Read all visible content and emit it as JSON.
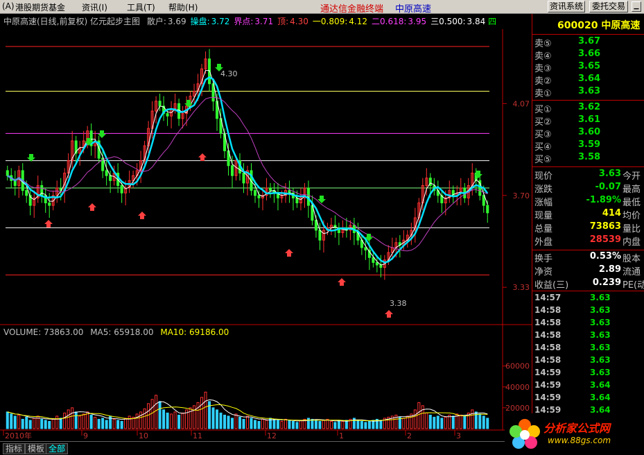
{
  "menu": {
    "items": [
      "(A)",
      "港股期货基金",
      "资讯(I)",
      "工具(T)",
      "帮助(H)"
    ],
    "title": "通达信金融终端",
    "stock": "中原高速",
    "buttons": [
      "资讯系统",
      "委托交易"
    ]
  },
  "chart_header": {
    "name": "中原高速(日线,前复权) 亿元起步主图",
    "fields": [
      {
        "label": "散户:",
        "value": "3.69",
        "color": "#c0c0c0"
      },
      {
        "label": "操盘:",
        "value": "3.72",
        "color": "#00ffff"
      },
      {
        "label": "界点:",
        "value": "3.71",
        "color": "#ff40ff"
      },
      {
        "label": "顶:",
        "value": "4.30",
        "color": "#ff4040"
      },
      {
        "label": "一0.809:",
        "value": "4.12",
        "color": "#ffff00"
      },
      {
        "label": "二0.618:",
        "value": "3.95",
        "color": "#ff40ff"
      },
      {
        "label": "三0.500:",
        "value": "3.84",
        "color": "#ffffff"
      }
    ],
    "end_icon": "四"
  },
  "volume_header": {
    "volume": "VOLUME: 73863.00",
    "ma5": "MA5: 65918.00",
    "ma10": "MA10: 69186.00"
  },
  "chart_data": {
    "type": "candlestick",
    "price_ticks": [
      "4.07",
      "3.70",
      "3.33"
    ],
    "volume_ticks": [
      "60000",
      "40000",
      "20000"
    ],
    "date_labels": [
      "2010年",
      "9",
      "10",
      "11",
      "12",
      "1",
      "2",
      "3"
    ],
    "annotations": [
      "4.30",
      "3.38"
    ],
    "levels": [
      4.3,
      4.12,
      3.95,
      3.84,
      3.73,
      3.57,
      3.38
    ],
    "level_colors": [
      "#ff2020",
      "#ffff60",
      "#ff40ff",
      "#ffffff",
      "#80ff80",
      "#ffffff",
      "#ff2020"
    ],
    "price_min": 3.23,
    "price_max": 4.37,
    "vol_max": 85000,
    "closes": [
      3.78,
      3.76,
      3.74,
      3.8,
      3.72,
      3.7,
      3.66,
      3.69,
      3.74,
      3.7,
      3.67,
      3.66,
      3.7,
      3.73,
      3.72,
      3.79,
      3.84,
      3.92,
      3.87,
      3.89,
      3.92,
      3.96,
      3.9,
      3.92,
      3.85,
      3.8,
      3.78,
      3.76,
      3.79,
      3.74,
      3.71,
      3.73,
      3.76,
      3.78,
      3.8,
      3.84,
      3.9,
      3.97,
      4.04,
      4.08,
      4.06,
      4.03,
      4.02,
      4.05,
      4.07,
      4.01,
      4.03,
      4.06,
      4.1,
      4.12,
      4.15,
      4.21,
      4.25,
      4.15,
      4.08,
      4.01,
      3.95,
      3.88,
      3.82,
      3.78,
      3.84,
      3.79,
      3.75,
      3.8,
      3.72,
      3.7,
      3.69,
      3.7,
      3.73,
      3.72,
      3.71,
      3.69,
      3.7,
      3.72,
      3.71,
      3.69,
      3.67,
      3.69,
      3.73,
      3.66,
      3.6,
      3.56,
      3.52,
      3.56,
      3.57,
      3.58,
      3.57,
      3.55,
      3.57,
      3.56,
      3.58,
      3.55,
      3.52,
      3.49,
      3.48,
      3.45,
      3.43,
      3.42,
      3.41,
      3.44,
      3.47,
      3.49,
      3.51,
      3.5,
      3.52,
      3.54,
      3.56,
      3.61,
      3.67,
      3.74,
      3.77,
      3.74,
      3.72,
      3.7,
      3.67,
      3.69,
      3.72,
      3.7,
      3.71,
      3.73,
      3.69,
      3.74,
      3.79,
      3.76,
      3.7,
      3.66,
      3.63
    ],
    "volumes": [
      16000,
      14000,
      12000,
      13000,
      9000,
      11000,
      8000,
      10000,
      12000,
      9000,
      8000,
      7000,
      9000,
      12000,
      10000,
      15000,
      18000,
      20000,
      16000,
      12000,
      14000,
      16000,
      13000,
      11000,
      9000,
      10000,
      8000,
      12000,
      9000,
      8000,
      7000,
      10000,
      12000,
      11000,
      14000,
      16000,
      19000,
      24000,
      28000,
      32000,
      26000,
      18000,
      15000,
      14000,
      16000,
      13000,
      15000,
      18000,
      20000,
      22000,
      25000,
      30000,
      35000,
      26000,
      20000,
      18000,
      15000,
      13000,
      12000,
      10000,
      14000,
      11000,
      9000,
      12000,
      10000,
      8000,
      7000,
      9000,
      8000,
      10000,
      9000,
      8000,
      7000,
      9000,
      8000,
      7000,
      6000,
      8000,
      9000,
      10000,
      9000,
      8000,
      7000,
      8000,
      9000,
      7000,
      6000,
      8000,
      7000,
      8000,
      9000,
      10000,
      8000,
      7000,
      6000,
      7000,
      8000,
      9000,
      8000,
      10000,
      11000,
      12000,
      13000,
      11000,
      10000,
      12000,
      14000,
      18000,
      25000,
      22000,
      15000,
      13000,
      11000,
      12000,
      10000,
      11000,
      13000,
      12000,
      14000,
      13000,
      12000,
      15000,
      18000,
      16000,
      14000,
      12000,
      10000
    ]
  },
  "quote": {
    "code": "600020 中原高速",
    "asks": [
      {
        "label": "卖⑤",
        "price": "3.67"
      },
      {
        "label": "卖④",
        "price": "3.66"
      },
      {
        "label": "卖③",
        "price": "3.65"
      },
      {
        "label": "卖②",
        "price": "3.64"
      },
      {
        "label": "卖①",
        "price": "3.63"
      }
    ],
    "bids": [
      {
        "label": "买①",
        "price": "3.62"
      },
      {
        "label": "买②",
        "price": "3.61"
      },
      {
        "label": "买③",
        "price": "3.60"
      },
      {
        "label": "买④",
        "price": "3.59"
      },
      {
        "label": "买⑤",
        "price": "3.58"
      }
    ],
    "stats": [
      {
        "l1": "现价",
        "v1": "3.63",
        "c1": "#00e000",
        "l2": "今开"
      },
      {
        "l1": "涨跌",
        "v1": "-0.07",
        "c1": "#00e000",
        "l2": "最高"
      },
      {
        "l1": "涨幅",
        "v1": "-1.89%",
        "c1": "#00e000",
        "l2": "最低"
      },
      {
        "l1": "现量",
        "v1": "414",
        "c1": "#ffff00",
        "l2": "均价"
      },
      {
        "l1": "总量",
        "v1": "73863",
        "c1": "#ffff00",
        "l2": "量比"
      },
      {
        "l1": "外盘",
        "v1": "28539",
        "c1": "#ff3030",
        "l2": "内盘"
      }
    ],
    "stats2": [
      {
        "l1": "换手",
        "v1": "0.53%",
        "c1": "#ffffff",
        "l2": "股本"
      },
      {
        "l1": "净资",
        "v1": "2.89",
        "c1": "#ffffff",
        "l2": "流通"
      },
      {
        "l1": "收益(三)",
        "v1": "0.239",
        "c1": "#ffffff",
        "l2": "PE(动)"
      }
    ],
    "ticks": [
      {
        "time": "14:57",
        "price": "3.63"
      },
      {
        "time": "14:58",
        "price": "3.63"
      },
      {
        "time": "14:58",
        "price": "3.63"
      },
      {
        "time": "14:58",
        "price": "3.63"
      },
      {
        "time": "14:58",
        "price": "3.63"
      },
      {
        "time": "14:58",
        "price": "3.63"
      },
      {
        "time": "14:59",
        "price": "3.63"
      },
      {
        "time": "14:59",
        "price": "3.64"
      },
      {
        "time": "14:59",
        "price": "3.64"
      },
      {
        "time": "14:59",
        "price": "3.64"
      }
    ]
  },
  "tabs": [
    "指标",
    "模板",
    "全部"
  ],
  "watermark": {
    "main": "分析家公式网",
    "sub": "www.88gs.com"
  }
}
